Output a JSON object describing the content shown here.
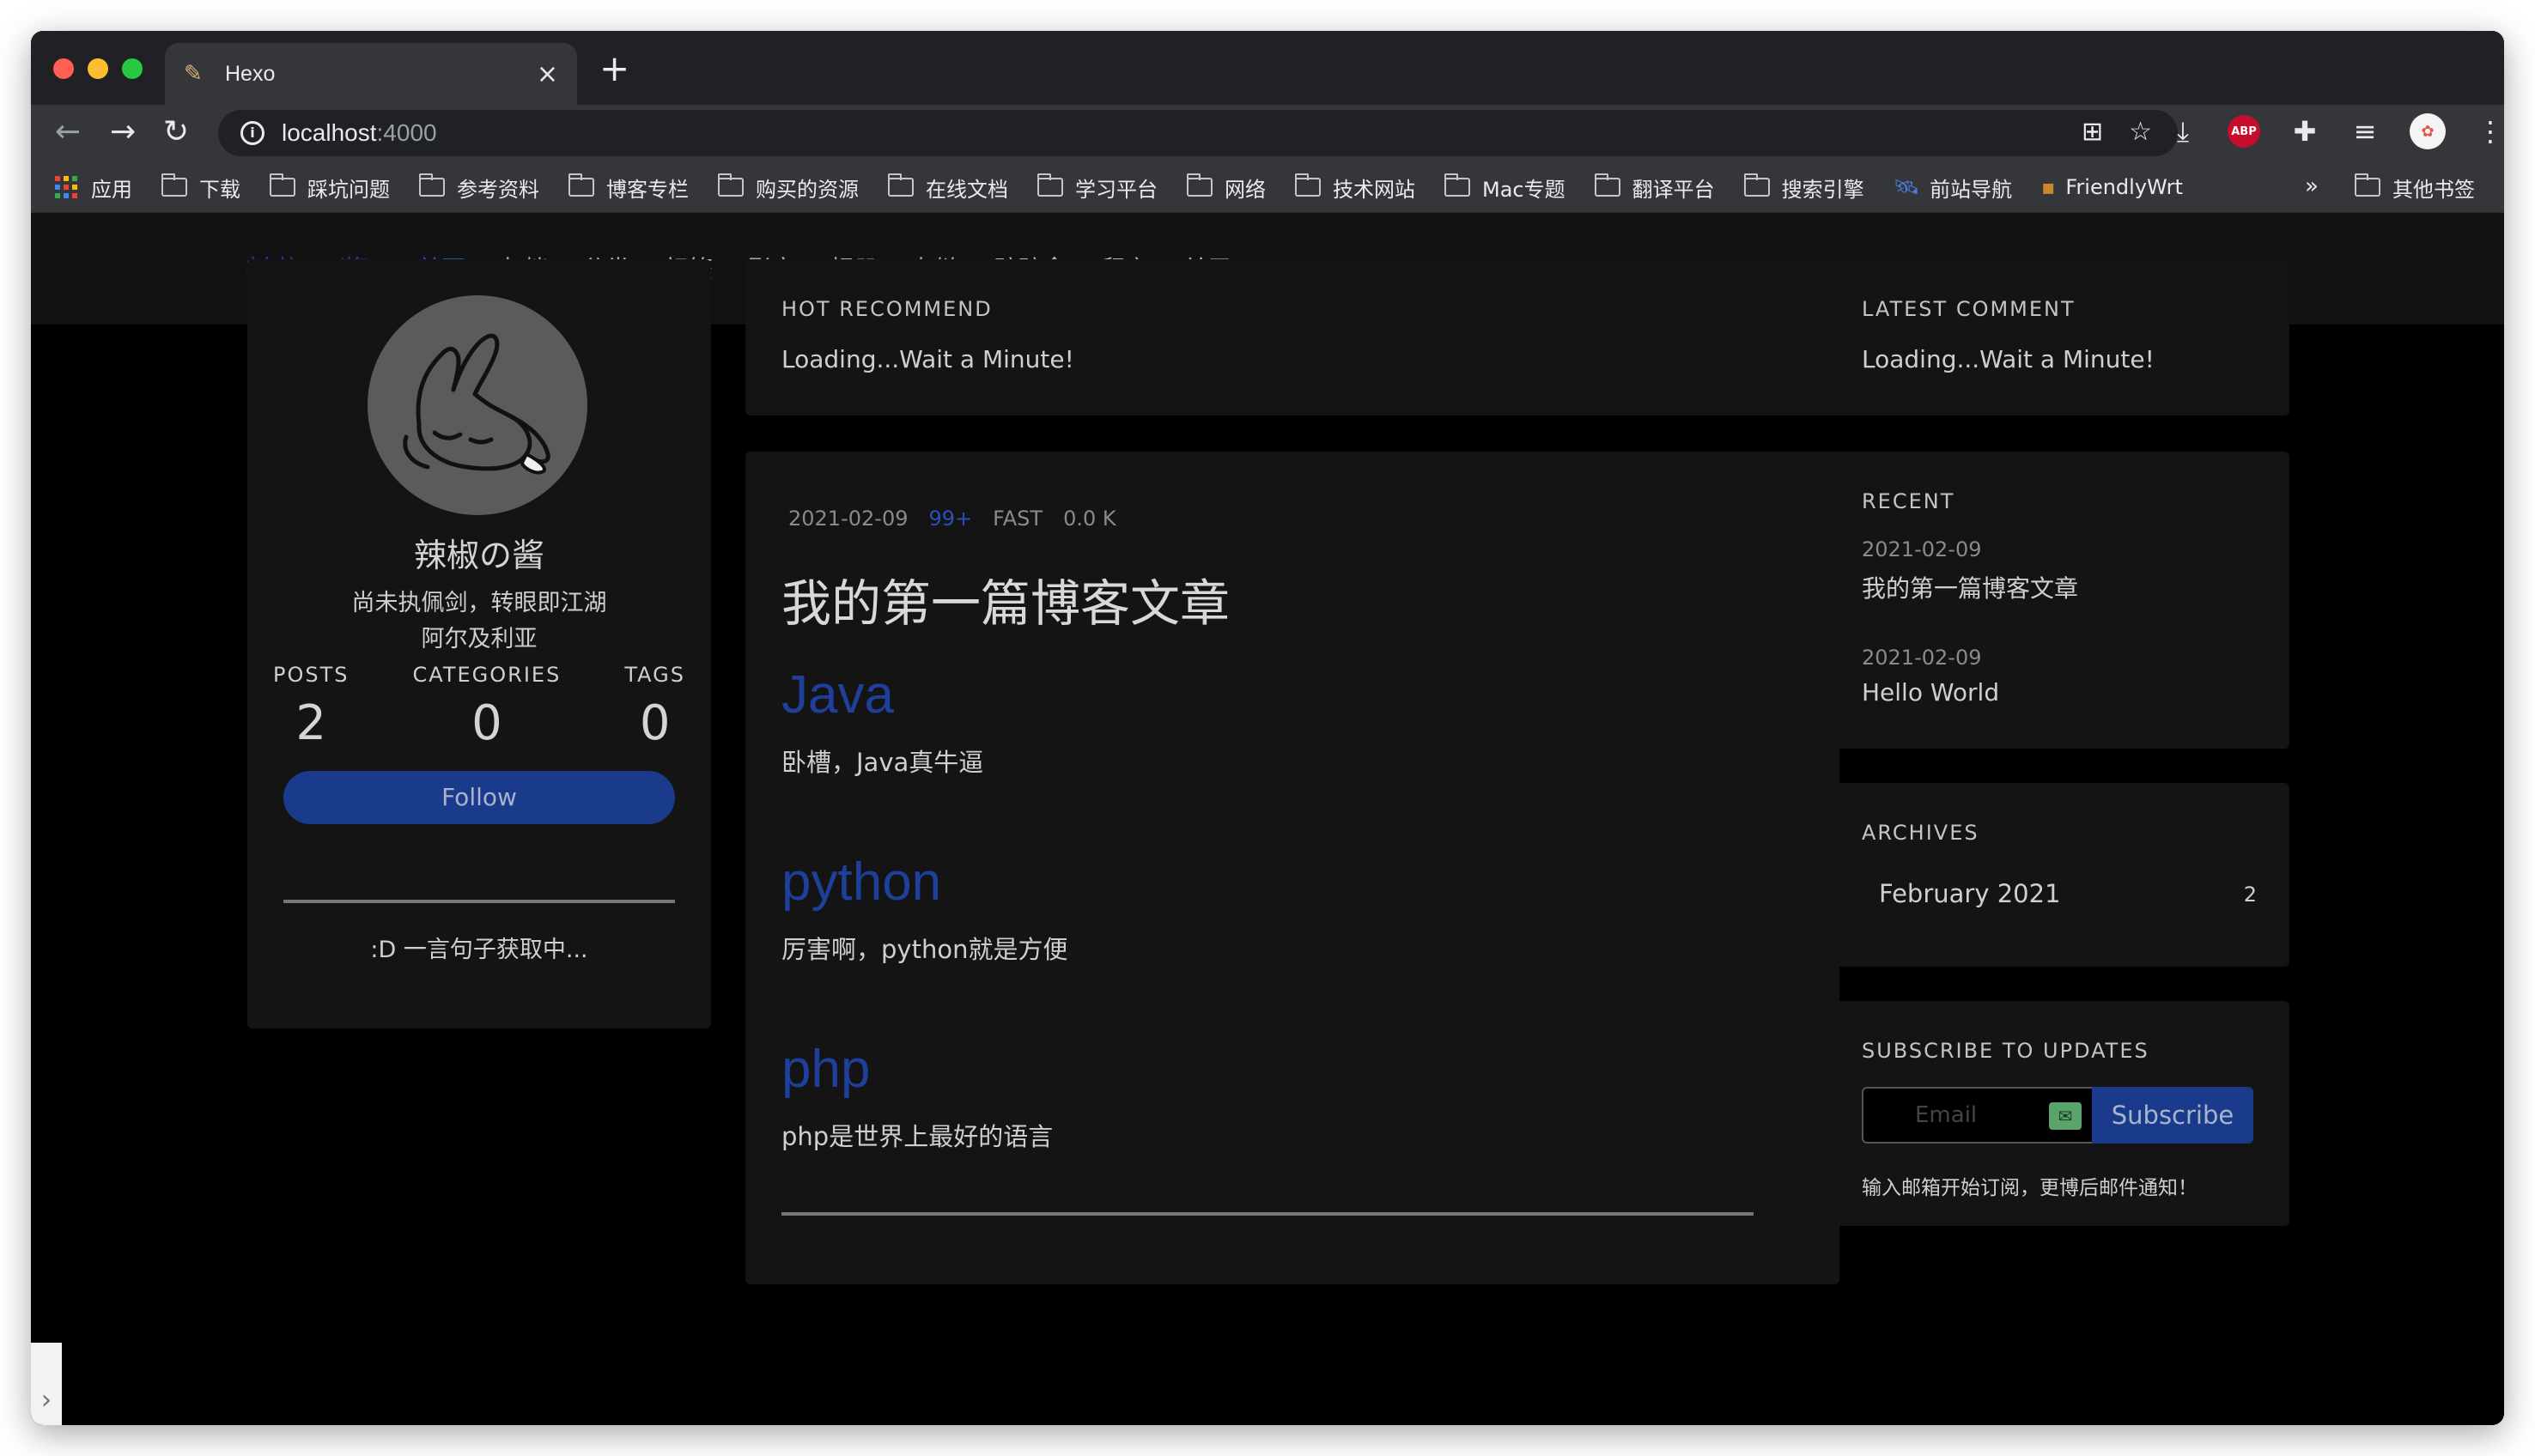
{
  "browser": {
    "tab_title": "Hexo",
    "url_host": "localhost",
    "url_port": ":4000",
    "bookmarks": [
      {
        "label": "应用",
        "kind": "apps"
      },
      {
        "label": "下载",
        "kind": "folder"
      },
      {
        "label": "踩坑问题",
        "kind": "folder"
      },
      {
        "label": "参考资料",
        "kind": "folder"
      },
      {
        "label": "博客专栏",
        "kind": "folder"
      },
      {
        "label": "购买的资源",
        "kind": "folder"
      },
      {
        "label": "在线文档",
        "kind": "folder"
      },
      {
        "label": "学习平台",
        "kind": "folder"
      },
      {
        "label": "网络",
        "kind": "folder"
      },
      {
        "label": "技术网站",
        "kind": "folder"
      },
      {
        "label": "Mac专题",
        "kind": "folder"
      },
      {
        "label": "翻译平台",
        "kind": "folder"
      },
      {
        "label": "搜索引擎",
        "kind": "folder"
      },
      {
        "label": "前站导航",
        "kind": "globe"
      },
      {
        "label": "FriendlyWrt",
        "kind": "site"
      }
    ],
    "bookmarks_more": "»",
    "other_bookmarks": "其他书签",
    "abp_label": "ABP"
  },
  "site": {
    "brand": "辣椒の酱",
    "nav": [
      {
        "label": "首页",
        "active": true
      },
      {
        "label": "归档",
        "active": false
      },
      {
        "label": "分类",
        "active": false
      },
      {
        "label": "标签",
        "active": false
      },
      {
        "label": "影音",
        "active": false
      },
      {
        "label": "相册",
        "active": false
      },
      {
        "label": "友链",
        "active": false
      },
      {
        "label": "碎碎念",
        "active": false
      },
      {
        "label": "留言",
        "active": false
      },
      {
        "label": "关于",
        "active": false
      }
    ]
  },
  "profile": {
    "name": "辣椒の酱",
    "motto": "尚未执佩剑，转眼即江湖",
    "location": "阿尔及利亚",
    "stats": [
      {
        "label": "POSTS",
        "value": "2"
      },
      {
        "label": "CATEGORIES",
        "value": "0"
      },
      {
        "label": "TAGS",
        "value": "0"
      }
    ],
    "follow_label": "Follow",
    "quote": ":D 一言句子获取中..."
  },
  "hot": {
    "label": "HOT RECOMMEND",
    "text": "Loading...Wait a Minute!"
  },
  "post": {
    "date": "2021-02-09",
    "hot": "99+",
    "speed": "FAST",
    "size": "0.0 K",
    "title": "我的第一篇博客文章",
    "sections": [
      {
        "heading": "Java",
        "body": "卧槽，Java真牛逼"
      },
      {
        "heading": "python",
        "body": "厉害啊，python就是方便"
      },
      {
        "heading": "php",
        "body": "php是世界上最好的语言"
      }
    ]
  },
  "latest": {
    "label": "LATEST COMMENT",
    "text": "Loading...Wait a Minute!"
  },
  "recent": {
    "label": "RECENT",
    "items": [
      {
        "date": "2021-02-09",
        "title": "我的第一篇博客文章"
      },
      {
        "date": "2021-02-09",
        "title": "Hello World"
      }
    ]
  },
  "archives": {
    "label": "ARCHIVES",
    "items": [
      {
        "month": "February 2021",
        "count": "2"
      }
    ]
  },
  "subscribe": {
    "label": "SUBSCRIBE TO UPDATES",
    "placeholder": "Email",
    "button": "Subscribe",
    "hint": "输入邮箱开始订阅，更博后邮件通知！"
  },
  "colors": {
    "accent": "#1a3a8c",
    "link_active": "#2a4fb8",
    "card_bg": "#141414",
    "page_bg": "#000000"
  }
}
